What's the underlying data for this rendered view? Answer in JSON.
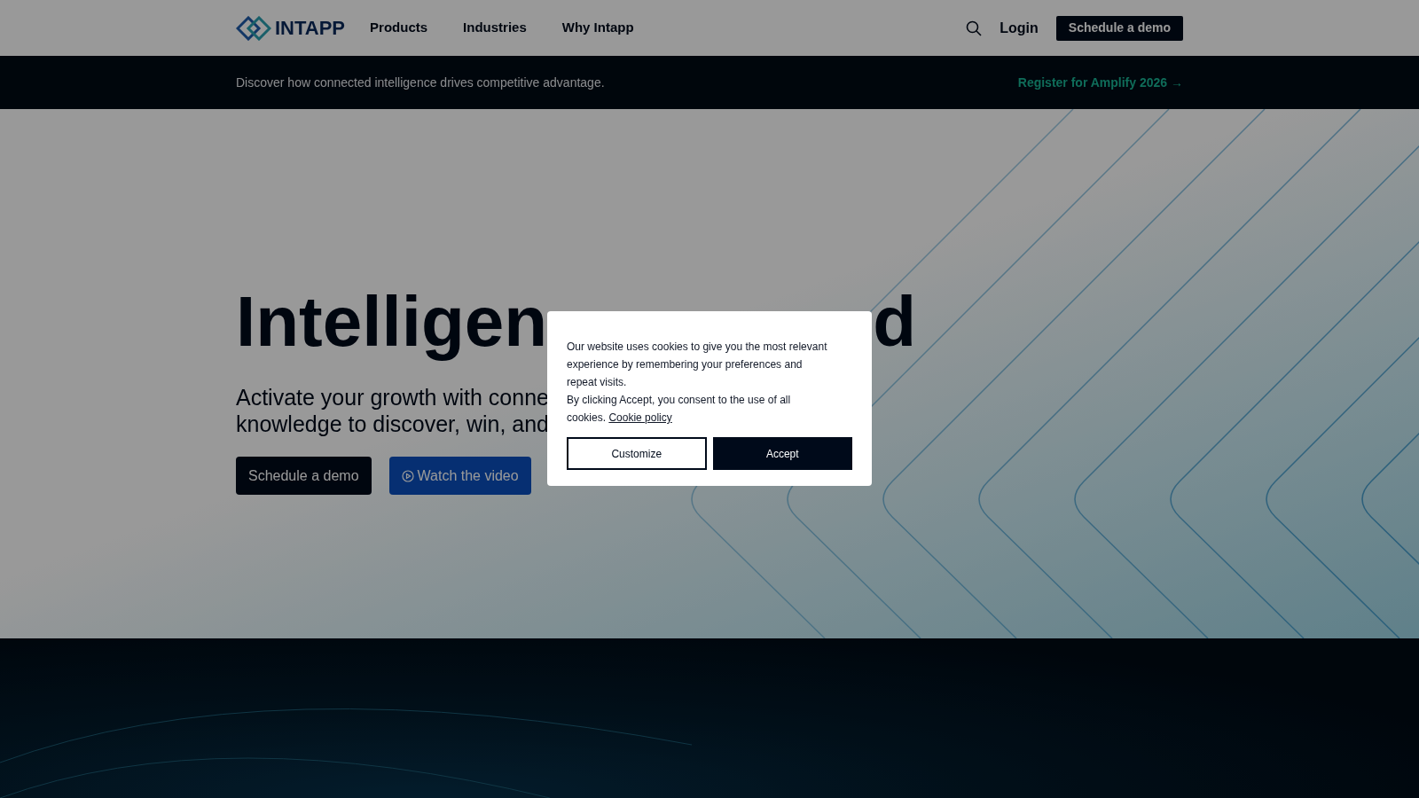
{
  "header": {
    "logo": "INTAPP",
    "nav": [
      "Products",
      "Industries",
      "Why Intapp"
    ],
    "login": "Login",
    "cta": "Schedule a demo"
  },
  "banner": {
    "text": "Discover how connected intelligence drives competitive advantage.",
    "link": "Register for Amplify 2026 →"
  },
  "hero": {
    "title_parts": [
      "Intelligen",
      "d"
    ],
    "subtitle_lines": [
      "Activate your growth with conne",
      "knowledge to discover, win, and"
    ],
    "primary_button": "Schedule a demo",
    "video_button": "Watch the video"
  },
  "cookie_dialog": {
    "text_lines": [
      "Our website uses cookies to give you the most relevant experience by remembering your preferences and repeat visits.",
      "By clicking Accept, you consent to the use of all cookies."
    ],
    "link": "Cookie policy",
    "buttons": [
      {
        "label": "Customize",
        "kind": "outline"
      },
      {
        "label": "Accept",
        "kind": "filled"
      }
    ]
  }
}
